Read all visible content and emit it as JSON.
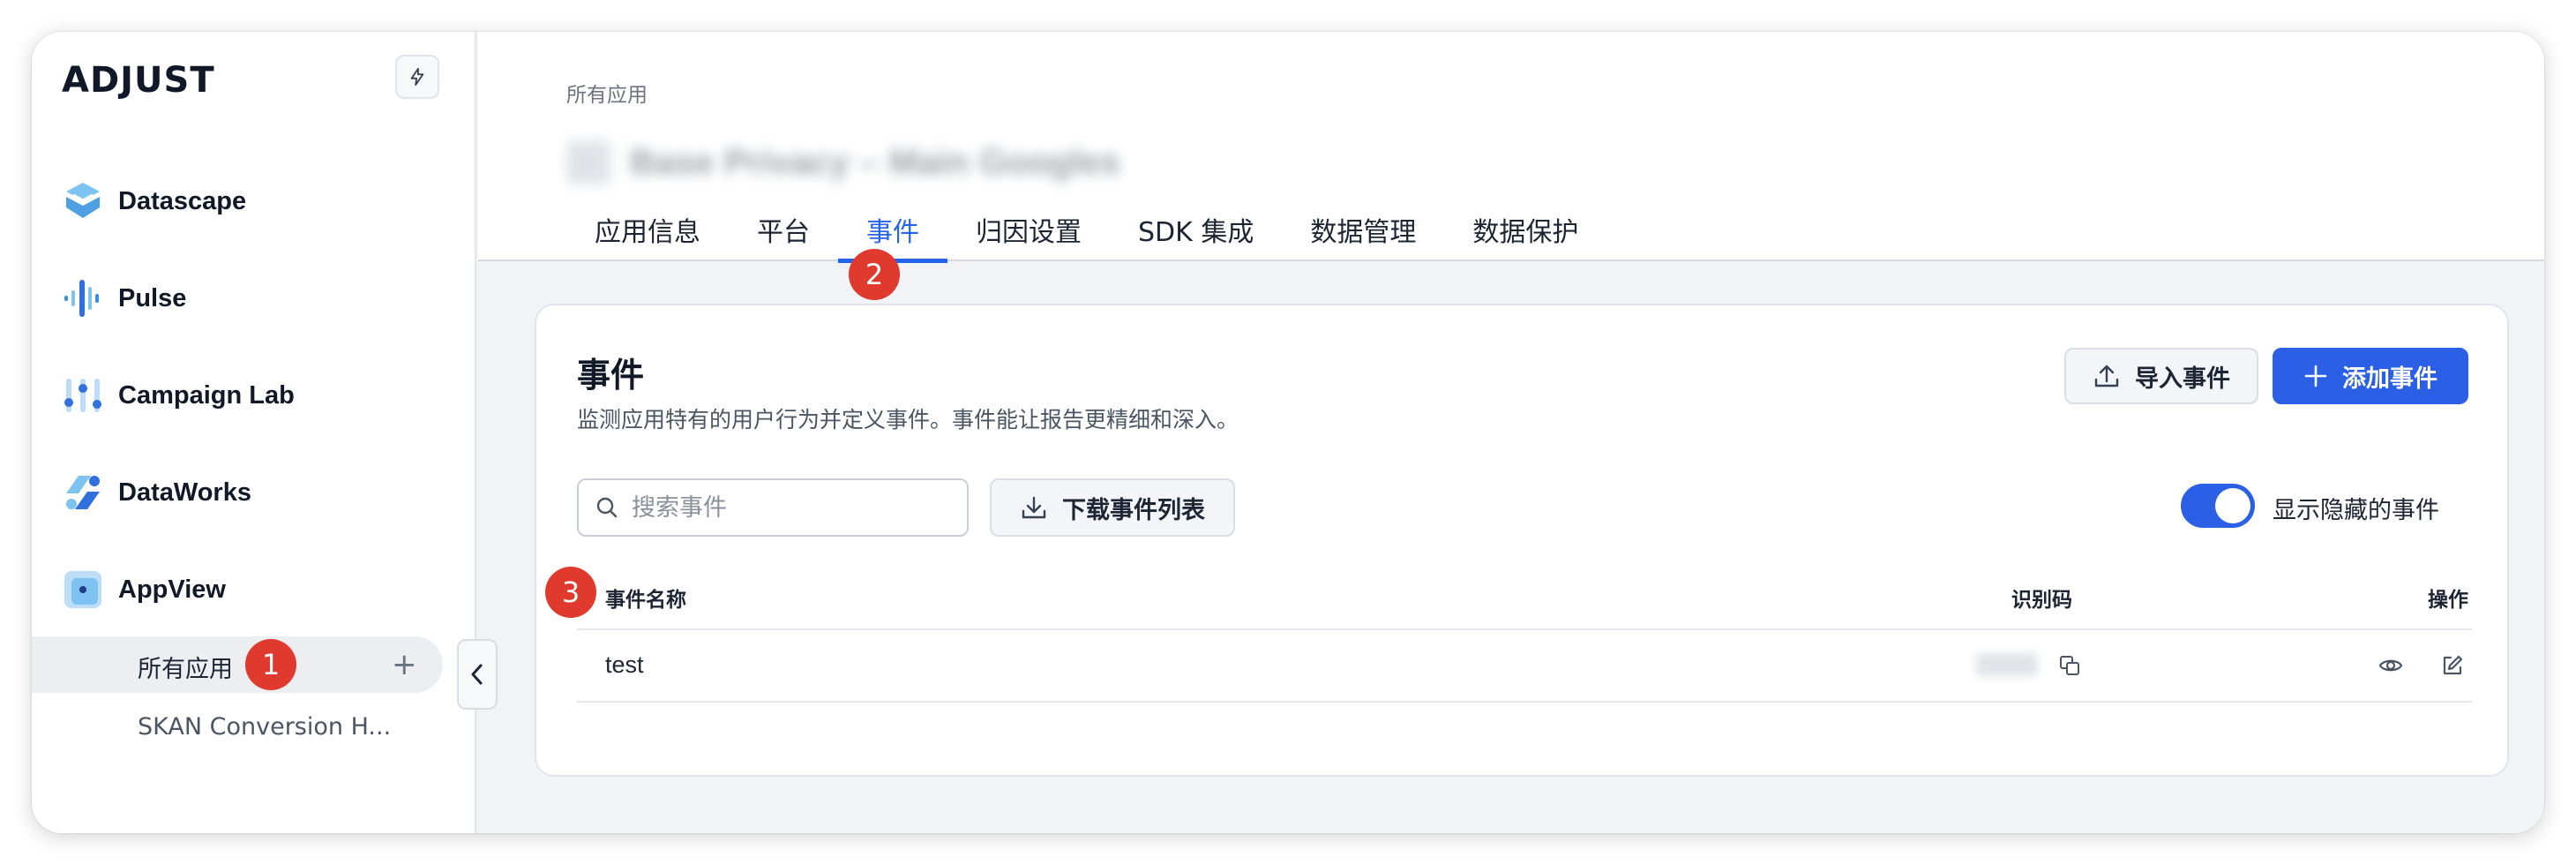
{
  "sidebar": {
    "logo": "ADJUST",
    "items": [
      {
        "label": "Datascape",
        "icon": "datascape-icon"
      },
      {
        "label": "Pulse",
        "icon": "pulse-icon"
      },
      {
        "label": "Campaign Lab",
        "icon": "campaign-lab-icon"
      },
      {
        "label": "DataWorks",
        "icon": "dataworks-icon"
      },
      {
        "label": "AppView",
        "icon": "appview-icon"
      }
    ],
    "sub_items": [
      {
        "label": "所有应用",
        "active": true
      },
      {
        "label": "SKAN Conversion H..."
      }
    ],
    "add_label": "+"
  },
  "header": {
    "breadcrumb": "所有应用",
    "app_name": "Base Privacy – Main Googles",
    "tabs": [
      {
        "label": "应用信息"
      },
      {
        "label": "平台"
      },
      {
        "label": "事件",
        "active": true
      },
      {
        "label": "归因设置"
      },
      {
        "label": "SDK 集成"
      },
      {
        "label": "数据管理"
      },
      {
        "label": "数据保护"
      }
    ]
  },
  "badges": [
    "1",
    "2",
    "3"
  ],
  "events": {
    "title": "事件",
    "description": "监测应用特有的用户行为并定义事件。事件能让报告更精细和深入。",
    "import_label": "导入事件",
    "add_label": "添加事件",
    "search_placeholder": "搜索事件",
    "download_label": "下载事件列表",
    "toggle_label": "显示隐藏的事件",
    "toggle_on": true,
    "columns": {
      "name": "事件名称",
      "token": "识别码",
      "actions": "操作"
    },
    "rows": [
      {
        "name": "test"
      }
    ]
  },
  "colors": {
    "accent": "#2a5fe6",
    "badge": "#e03a2f"
  }
}
